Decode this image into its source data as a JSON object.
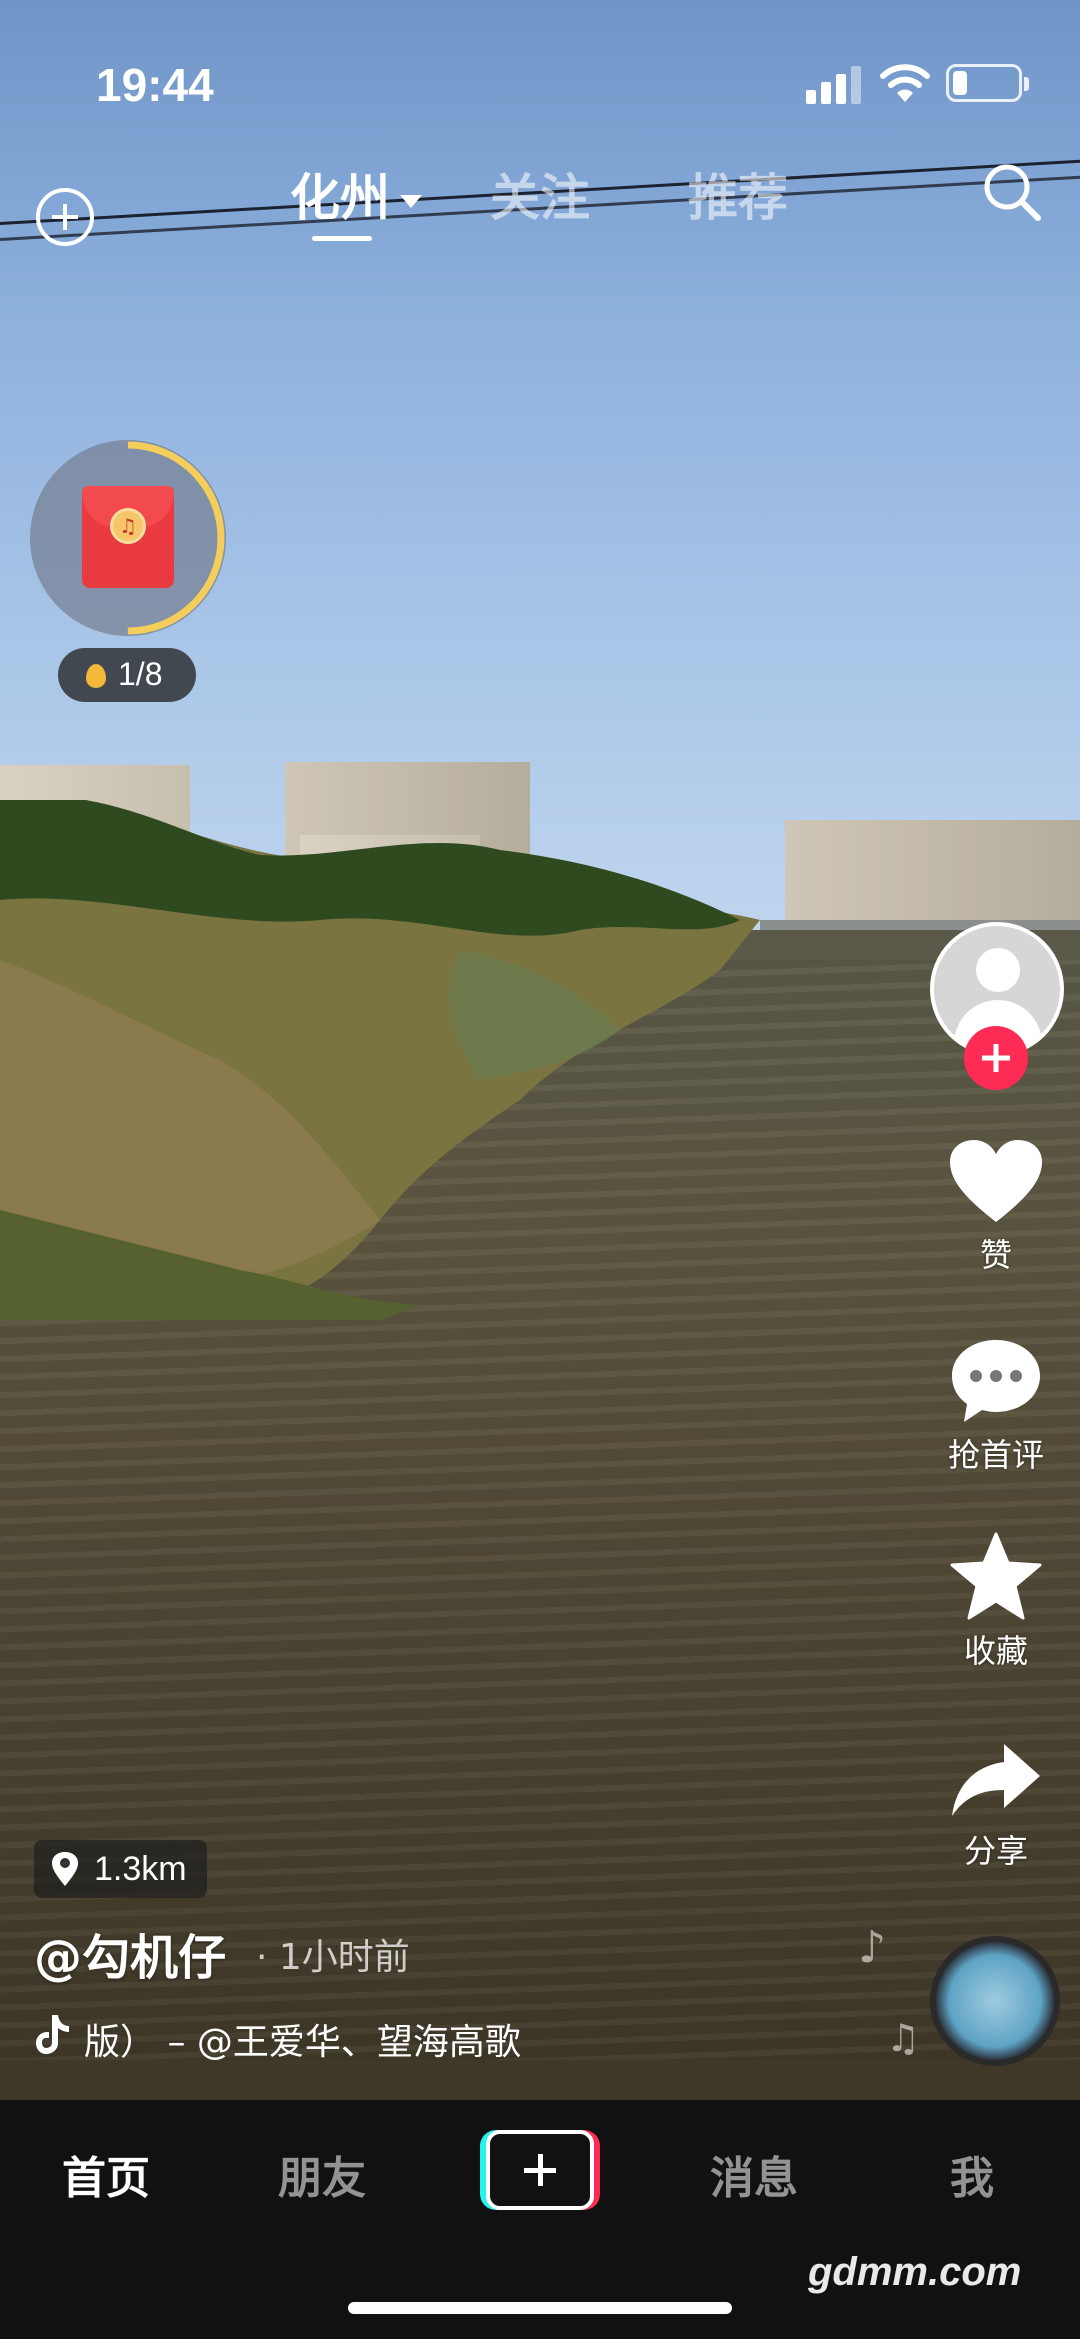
{
  "status_bar": {
    "time": "19:44"
  },
  "top_nav": {
    "tabs": [
      {
        "label": "化州",
        "active": true
      },
      {
        "label": "关注",
        "active": false
      },
      {
        "label": "推荐",
        "active": false
      }
    ]
  },
  "red_packet": {
    "progress_label": "1/8",
    "ring_progress": 0.5
  },
  "actions": {
    "like": "赞",
    "comment": "抢首评",
    "favorite": "收藏",
    "share": "分享"
  },
  "video_info": {
    "location_distance": "1.3km",
    "author": "@勾机仔",
    "time_ago": "· 1小时前",
    "song": "版） – @王爱华、望海高歌"
  },
  "bottom_nav": {
    "home": "首页",
    "friends": "朋友",
    "messages": "消息",
    "me": "我"
  },
  "watermark": "gdmm.com",
  "colors": {
    "accent": "#fe2c55",
    "cyan": "#25f4ee"
  }
}
